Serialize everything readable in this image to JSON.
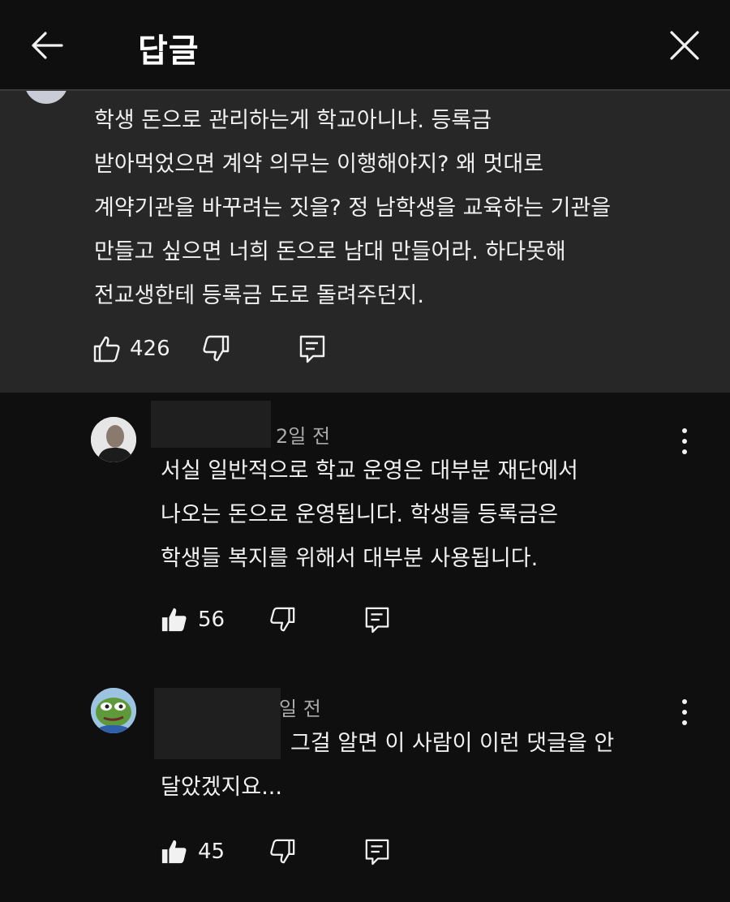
{
  "header": {
    "title": "답글",
    "back_icon": "arrow-left-icon",
    "close_icon": "close-icon"
  },
  "parent_comment": {
    "text_lines": [
      "학생 돈으로 관리하는게 학교아니냐. 등록금",
      "받아먹었으면 계약 의무는 이행해야지? 왜 멋대로",
      "계약기관을 바꾸려는 짓을? 정 남학생을 교육하는 기관을",
      "만들고 싶으면 너희 돈으로 남대 만들어라. 하다못해",
      "전교생한테 등록금 도로 돌려주던지."
    ],
    "likes": "426"
  },
  "replies": [
    {
      "time": "2일 전",
      "text_lines": [
        "서실 일반적으로 학교 운영은 대부분 재단에서",
        "나오는 돈으로 운영됩니다. 학생들 등록금은",
        "학생들 복지를 위해서 대부분 사용됩니다."
      ],
      "likes": "56"
    },
    {
      "time": "일 전",
      "text_lines": [
        "그걸 알면 이 사람이 이런 댓글을 안",
        "달았겠지요..."
      ],
      "likes": "45"
    }
  ],
  "colors": {
    "background": "#0f0f0f",
    "parent_background": "#272727",
    "text": "#f1f1f1",
    "meta_text": "#aaaaaa"
  }
}
